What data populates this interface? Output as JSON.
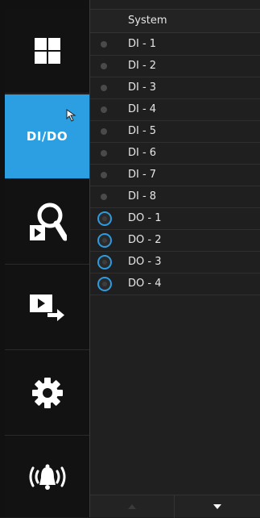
{
  "sidebar": {
    "items": [
      {
        "name": "layout",
        "icon": "layout-grid-icon"
      },
      {
        "name": "dido",
        "label": "DI/DO",
        "icon": "",
        "active": true
      },
      {
        "name": "search",
        "icon": "search-playback-icon"
      },
      {
        "name": "export",
        "icon": "video-export-icon"
      },
      {
        "name": "settings",
        "icon": "gear-icon"
      },
      {
        "name": "alarm",
        "icon": "alarm-bell-icon"
      }
    ]
  },
  "panel": {
    "header": "System",
    "inputs": [
      {
        "label": "DI - 1"
      },
      {
        "label": "DI - 2"
      },
      {
        "label": "DI - 3"
      },
      {
        "label": "DI - 4"
      },
      {
        "label": "DI - 5"
      },
      {
        "label": "DI - 6"
      },
      {
        "label": "DI - 7"
      },
      {
        "label": "DI - 8"
      }
    ],
    "outputs": [
      {
        "label": "DO - 1"
      },
      {
        "label": "DO - 2"
      },
      {
        "label": "DO - 3"
      },
      {
        "label": "DO - 4"
      }
    ]
  },
  "colors": {
    "accent": "#2b9fe2",
    "background": "#1b1b1b"
  }
}
